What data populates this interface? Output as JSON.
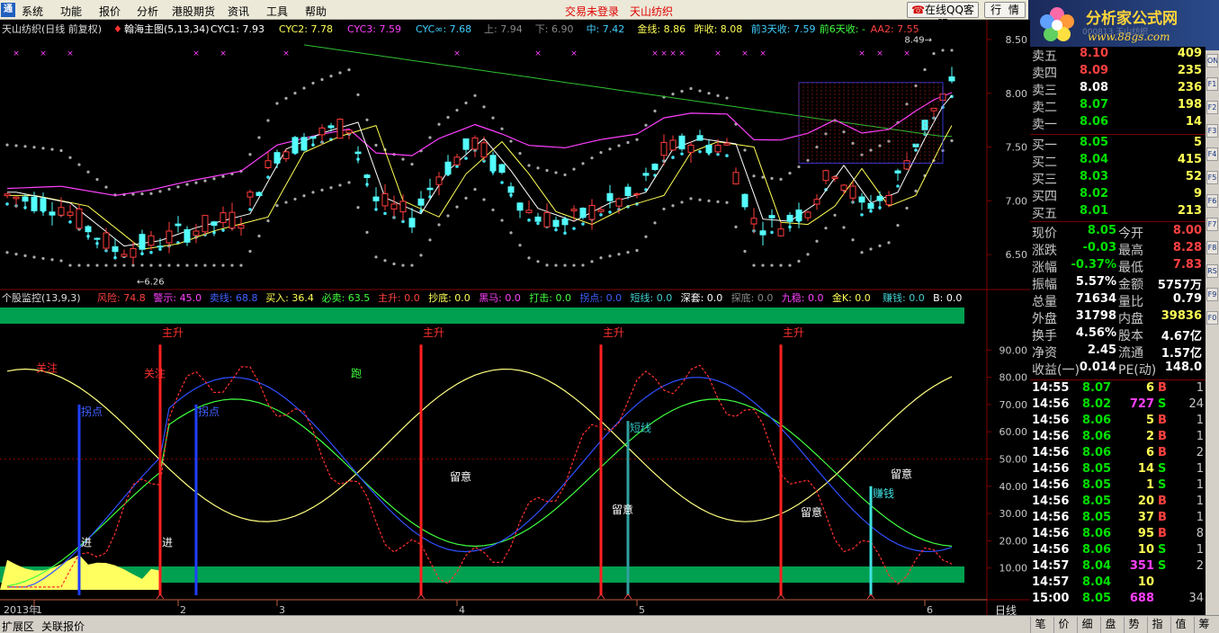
{
  "menubar": {
    "logo": "通",
    "items": [
      "系统",
      "功能",
      "报价",
      "分析",
      "港股期货",
      "资讯",
      "工具",
      "帮助"
    ],
    "trade_status": "交易未登录",
    "stock_name": "天山纺织",
    "qq_service": "在线QQ客服",
    "btn_quote": "行",
    "btn_quote2": "情"
  },
  "brand": {
    "name": "分析家公式网",
    "url": "www.88gs.com",
    "code_ghost": "000813 天山纺织"
  },
  "main_legend": {
    "title": "天山纺织(日线 前复权)",
    "indicator": "翰海主图(5,13,34)",
    "items": [
      {
        "text": "CYC1: 7.93",
        "color": "#ffffff"
      },
      {
        "text": "CYC2: 7.78",
        "color": "#ffff55"
      },
      {
        "text": "CYC3: 7.59",
        "color": "#ff40ff"
      },
      {
        "text": "CYC∞: 7.68",
        "color": "#40d0ff"
      },
      {
        "text": "上: 7.94",
        "color": "#888888"
      },
      {
        "text": "下: 6.90",
        "color": "#888888"
      },
      {
        "text": "中: 7.42",
        "color": "#40d0ff"
      },
      {
        "text": "金线: 8.86",
        "color": "#ffff55"
      },
      {
        "text": "昨收: 8.08",
        "color": "#ffff55"
      },
      {
        "text": "前3天收: 7.59",
        "color": "#40d0ff"
      },
      {
        "text": "前6天收: -",
        "color": "#40ff40"
      },
      {
        "text": "AA2: 7.55",
        "color": "#ff4040"
      }
    ]
  },
  "ind_legend": {
    "title": "个股监控(13,9,3)",
    "items": [
      {
        "text": "风险: 74.8",
        "color": "#ff4040"
      },
      {
        "text": "警示: 45.0",
        "color": "#ff40ff"
      },
      {
        "text": "卖线: 68.8",
        "color": "#4060ff"
      },
      {
        "text": "买入: 36.4",
        "color": "#ffff55"
      },
      {
        "text": "必卖: 63.5",
        "color": "#40ff40"
      },
      {
        "text": "主升: 0.0",
        "color": "#ff4040"
      },
      {
        "text": "抄底: 0.0",
        "color": "#ffff55"
      },
      {
        "text": "黑马: 0.0",
        "color": "#ff40ff"
      },
      {
        "text": "打击: 0.0",
        "color": "#40ff40"
      },
      {
        "text": "拐点: 0.0",
        "color": "#4060ff"
      },
      {
        "text": "短线: 0.0",
        "color": "#40d0d0"
      },
      {
        "text": "深套: 0.0",
        "color": "#ffffff"
      },
      {
        "text": "探底: 0.0",
        "color": "#888888"
      },
      {
        "text": "九稳: 0.0",
        "color": "#ff40ff"
      },
      {
        "text": "金K: 0.0",
        "color": "#ffff55"
      },
      {
        "text": "赚钱: 0.0",
        "color": "#40d0d0"
      },
      {
        "text": "B: 0.0",
        "color": "#ffffff"
      }
    ]
  },
  "chart_data": {
    "type": "candlestick",
    "ylim": [
      6.2,
      8.6
    ],
    "price_ticks": [
      "8.50",
      "8.00",
      "7.50",
      "7.00",
      "6.50"
    ],
    "ind_ticks": [
      "90.00",
      "80.00",
      "70.00",
      "60.00",
      "50.00",
      "40.00",
      "30.00",
      "20.00",
      "10.00"
    ],
    "ind_ylim": [
      0,
      100
    ],
    "month_labels": [
      {
        "label": "2013年",
        "bar": 0
      },
      {
        "label": "1",
        "bar": 4
      },
      {
        "label": "2",
        "bar": 20
      },
      {
        "label": "3",
        "bar": 31
      },
      {
        "label": "4",
        "bar": 51
      },
      {
        "label": "5",
        "bar": 71
      },
      {
        "label": "6",
        "bar": 103
      }
    ],
    "axis_name": "日线",
    "hi_label": "8.49",
    "lo_label": "6.26",
    "signal_labels": [
      {
        "text": "主升",
        "bar": 17
      },
      {
        "text": "主升",
        "bar": 46
      },
      {
        "text": "主升",
        "bar": 66
      },
      {
        "text": "主升",
        "bar": 86
      },
      {
        "text": "拐点",
        "bar": 8
      },
      {
        "text": "拐点",
        "bar": 21
      },
      {
        "text": "短线",
        "bar": 69
      },
      {
        "text": "赚钱",
        "bar": 96
      },
      {
        "text": "进",
        "bar": 8
      },
      {
        "text": "进",
        "bar": 17
      },
      {
        "text": "留意",
        "bar": 49
      },
      {
        "text": "留意",
        "bar": 67
      },
      {
        "text": "留意",
        "bar": 88
      },
      {
        "text": "留意",
        "bar": 98
      },
      {
        "text": "关注",
        "bar": 3
      },
      {
        "text": "关注",
        "bar": 15
      },
      {
        "text": "跑",
        "bar": 38
      }
    ]
  },
  "quote": {
    "asks": [
      {
        "label": "卖五",
        "price": "8.10",
        "vol": "409"
      },
      {
        "label": "卖四",
        "price": "8.09",
        "vol": "235"
      },
      {
        "label": "卖三",
        "price": "8.08",
        "vol": "236"
      },
      {
        "label": "卖二",
        "price": "8.07",
        "vol": "198"
      },
      {
        "label": "卖一",
        "price": "8.06",
        "vol": "14"
      }
    ],
    "bids": [
      {
        "label": "买一",
        "price": "8.05",
        "vol": "5"
      },
      {
        "label": "买二",
        "price": "8.04",
        "vol": "415"
      },
      {
        "label": "买三",
        "price": "8.03",
        "vol": "52"
      },
      {
        "label": "买四",
        "price": "8.02",
        "vol": "9"
      },
      {
        "label": "买五",
        "price": "8.01",
        "vol": "213"
      }
    ],
    "stats": [
      [
        "现价",
        "8.05",
        "今开",
        "8.00"
      ],
      [
        "涨跌",
        "-0.03",
        "最高",
        "8.28"
      ],
      [
        "涨幅",
        "-0.37%",
        "最低",
        "7.83"
      ],
      [
        "振幅",
        "5.57%",
        "金额",
        "5757万"
      ],
      [
        "总量",
        "71634",
        "量比",
        "0.79"
      ],
      [
        "外盘",
        "31798",
        "内盘",
        "39836"
      ],
      [
        "换手",
        "4.56%",
        "股本",
        "4.67亿"
      ],
      [
        "净资",
        "2.45",
        "流通",
        "1.57亿"
      ],
      [
        "收益(一)",
        "0.014",
        "PE(动)",
        "148.0"
      ]
    ],
    "ticks": [
      [
        "14:55",
        "8.07",
        "6",
        "B",
        "1"
      ],
      [
        "14:56",
        "8.02",
        "727",
        "S",
        "24"
      ],
      [
        "14:56",
        "8.06",
        "5",
        "B",
        "1"
      ],
      [
        "14:56",
        "8.06",
        "2",
        "B",
        "1"
      ],
      [
        "14:56",
        "8.06",
        "6",
        "B",
        "2"
      ],
      [
        "14:56",
        "8.05",
        "14",
        "S",
        "1"
      ],
      [
        "14:56",
        "8.05",
        "1",
        "S",
        "1"
      ],
      [
        "14:56",
        "8.05",
        "20",
        "B",
        "1"
      ],
      [
        "14:56",
        "8.05",
        "37",
        "B",
        "1"
      ],
      [
        "14:56",
        "8.06",
        "95",
        "B",
        "8"
      ],
      [
        "14:56",
        "8.06",
        "10",
        "S",
        "1"
      ],
      [
        "14:57",
        "8.04",
        "351",
        "S",
        "2"
      ],
      [
        "14:57",
        "8.04",
        "10",
        "",
        ""
      ],
      [
        "15:00",
        "8.05",
        "688",
        "",
        "34"
      ]
    ]
  },
  "toolrail": [
    "ON",
    "F1",
    "F2",
    "F3",
    "F4",
    "F5",
    "F6",
    "F7",
    "F8",
    "RS",
    "F9",
    "F0"
  ],
  "bottom": {
    "left": [
      "扩展区",
      "关联报价"
    ],
    "tabs": [
      "笔",
      "价",
      "细",
      "盘",
      "势",
      "指",
      "值",
      "筹"
    ]
  },
  "colors": {
    "up": "#ff3c3c",
    "down": "#54ffff",
    "bid_green": "#00e000",
    "band_green": "#00a050"
  }
}
